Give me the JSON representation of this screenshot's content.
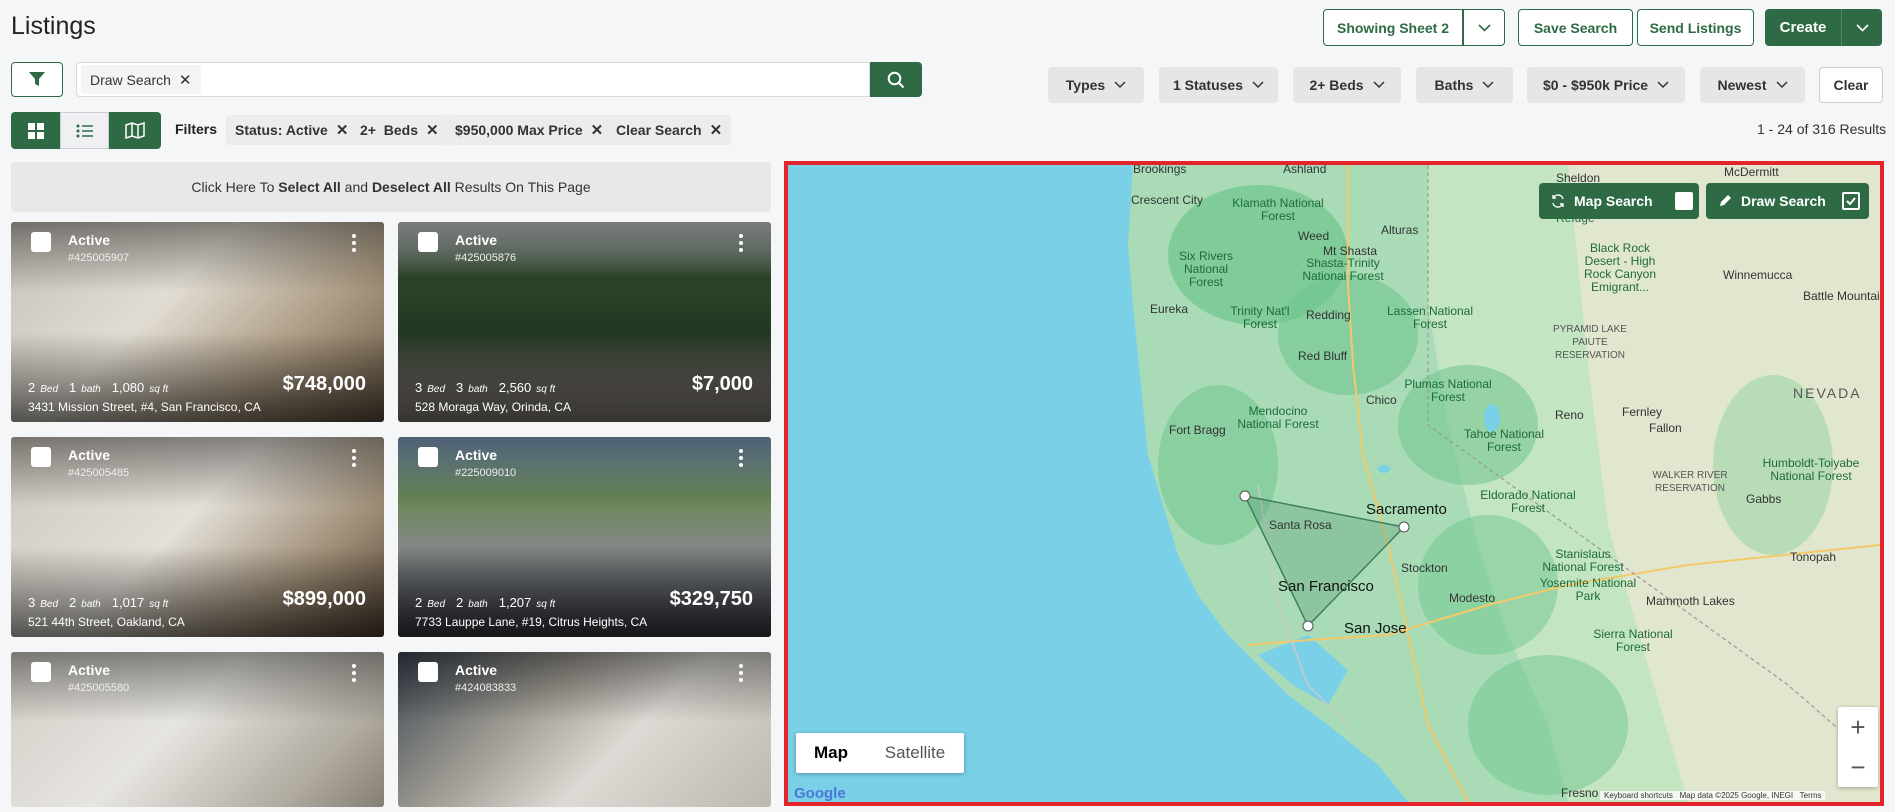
{
  "header": {
    "title": "Listings",
    "showing_sheet": "Showing Sheet 2",
    "save_search": "Save Search",
    "send_listings": "Send Listings",
    "create": "Create"
  },
  "search": {
    "draw_chip": "Draw Search"
  },
  "dropdowns": {
    "types": "Types",
    "statuses": "1 Statuses",
    "beds": "2+ Beds",
    "baths": "Baths",
    "price": "$0 - $950k Price",
    "sort": "Newest",
    "clear": "Clear"
  },
  "filters": {
    "label": "Filters",
    "chips": [
      "Status: Active",
      "2+  Beds",
      "$950,000 Max Price",
      "Clear Search"
    ],
    "results": "1 - 24 of 316 Results"
  },
  "select_bar": {
    "pre": "Click Here To ",
    "select_all": "Select All",
    "mid": " and ",
    "deselect_all": "Deselect All",
    "post": " Results On This Page"
  },
  "listings": [
    {
      "status": "Active",
      "mls": "#425005907",
      "beds": "2",
      "bed_unit": "Bed",
      "baths": "1",
      "bath_unit": "bath",
      "sqft": "1,080",
      "sqft_unit": "sq ft",
      "price": "$748,000",
      "address": "3431 Mission Street, #4, San Francisco, CA"
    },
    {
      "status": "Active",
      "mls": "#425005876",
      "beds": "3",
      "bed_unit": "Bed",
      "baths": "3",
      "bath_unit": "bath",
      "sqft": "2,560",
      "sqft_unit": "sq ft",
      "price": "$7,000",
      "address": "528 Moraga Way, Orinda, CA"
    },
    {
      "status": "Active",
      "mls": "#425005485",
      "beds": "3",
      "bed_unit": "Bed",
      "baths": "2",
      "bath_unit": "bath",
      "sqft": "1,017",
      "sqft_unit": "sq ft",
      "price": "$899,000",
      "address": "521 44th Street, Oakland, CA"
    },
    {
      "status": "Active",
      "mls": "#225009010",
      "beds": "2",
      "bed_unit": "Bed",
      "baths": "2",
      "bath_unit": "bath",
      "sqft": "1,207",
      "sqft_unit": "sq ft",
      "price": "$329,750",
      "address": "7733 Lauppe Lane, #19, Citrus Heights, CA"
    },
    {
      "status": "Active",
      "mls": "#425005580"
    },
    {
      "status": "Active",
      "mls": "#424083833"
    }
  ],
  "map": {
    "map_search": "Map Search",
    "draw_search": "Draw Search",
    "type_map": "Map",
    "type_satellite": "Satellite",
    "google": "Google",
    "attribution": "Keyboard shortcuts   Map data ©2025 Google, INEGI   Terms",
    "cities": [
      "Brookings",
      "Ashland",
      "McDermitt",
      "Crescent City",
      "Alturas",
      "Weed",
      "Mt Shasta",
      "Eureka",
      "Redding",
      "Red Bluff",
      "Chico",
      "Reno",
      "Fernley",
      "Fallon",
      "Fort Bragg",
      "Sacramento",
      "Santa Rosa",
      "Stockton",
      "San Francisco",
      "Modesto",
      "San Jose",
      "Fresno",
      "Winnemucca",
      "Battle Mountain",
      "Gabbs",
      "Tonopah",
      "Mammoth Lakes",
      "Sheldon"
    ],
    "regions": [
      "NEVADA",
      "PYRAMID LAKE PAIUTE RESERVATION",
      "WALKER RIVER RESERVATION"
    ],
    "parks": [
      "Klamath National Forest",
      "Six Rivers National Forest",
      "Shasta-Trinity National Forest",
      "Trinity Nat'l Forest",
      "Lassen National Forest",
      "Plumas National Forest",
      "Mendocino National Forest",
      "Tahoe National Forest",
      "Eldorado National Forest",
      "Stanislaus National Forest",
      "Yosemite National Park",
      "Sierra National Forest",
      "Humboldt-Toiyabe National Forest",
      "Black Rock Desert - High Rock Canyon Emigrant...",
      "Refuge"
    ],
    "zoom_in": "+",
    "zoom_out": "−"
  }
}
